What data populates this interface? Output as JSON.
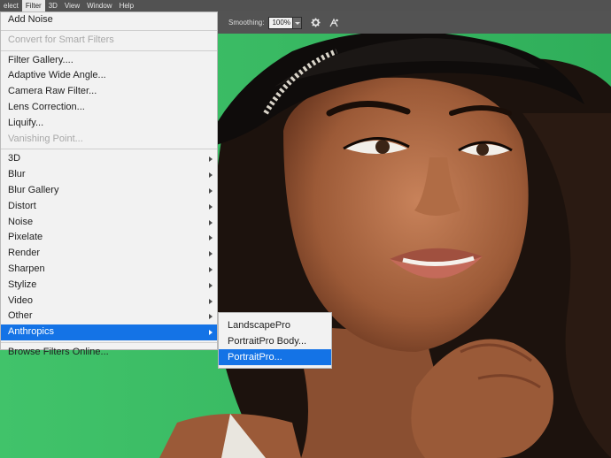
{
  "menubar": {
    "items": [
      "elect",
      "Filter",
      "3D",
      "View",
      "Window",
      "Help"
    ],
    "active_index": 1
  },
  "options": {
    "smoothing_label": "Smoothing:",
    "smoothing_value": "100%",
    "icons": [
      "chevron-down-icon",
      "gear-icon",
      "brush-symmetry-icon"
    ]
  },
  "filter_menu": {
    "top_items": [
      {
        "label": "Add Noise",
        "enabled": true
      }
    ],
    "smart_items": [
      {
        "label": "Convert for Smart Filters",
        "enabled": false
      }
    ],
    "special_items": [
      {
        "label": "Filter Gallery....",
        "enabled": true
      },
      {
        "label": "Adaptive Wide Angle...",
        "enabled": true
      },
      {
        "label": "Camera Raw Filter...",
        "enabled": true
      },
      {
        "label": "Lens Correction...",
        "enabled": true
      },
      {
        "label": "Liquify...",
        "enabled": true
      },
      {
        "label": "Vanishing Point...",
        "enabled": false
      }
    ],
    "submenu_items": [
      {
        "label": "3D"
      },
      {
        "label": "Blur"
      },
      {
        "label": "Blur Gallery"
      },
      {
        "label": "Distort"
      },
      {
        "label": "Noise"
      },
      {
        "label": "Pixelate"
      },
      {
        "label": "Render"
      },
      {
        "label": "Sharpen"
      },
      {
        "label": "Stylize"
      },
      {
        "label": "Video"
      },
      {
        "label": "Other"
      },
      {
        "label": "Anthropics",
        "highlighted": true
      }
    ],
    "bottom_items": [
      {
        "label": "Browse Filters Online..."
      }
    ]
  },
  "anthropics_submenu": {
    "items": [
      {
        "label": "LandscapePro"
      },
      {
        "label": "PortraitPro Body..."
      },
      {
        "label": "PortraitPro...",
        "highlighted": true
      }
    ]
  },
  "colors": {
    "accent": "#1473e6",
    "background_green": "#3fbf6b"
  }
}
